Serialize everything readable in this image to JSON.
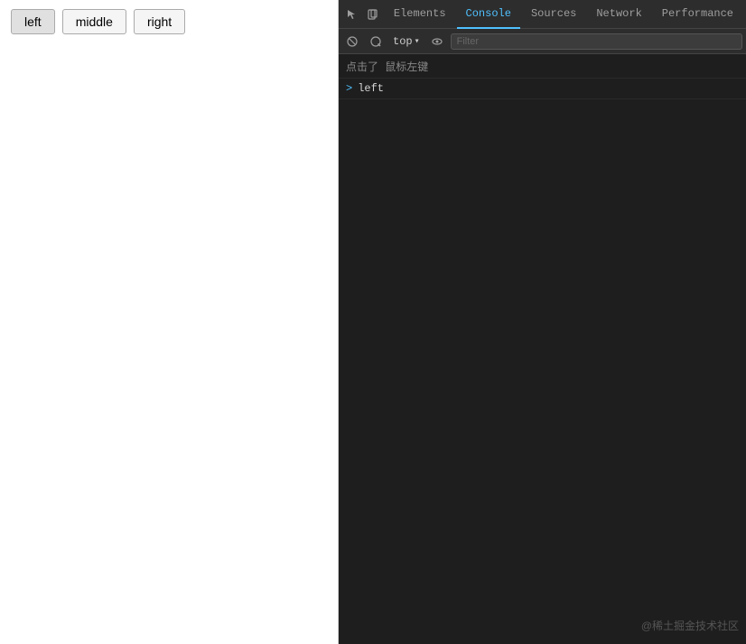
{
  "left_panel": {
    "buttons": [
      {
        "id": "btn-left",
        "label": "left",
        "active": true
      },
      {
        "id": "btn-middle",
        "label": "middle",
        "active": false
      },
      {
        "id": "btn-right",
        "label": "right",
        "active": false
      }
    ]
  },
  "devtools": {
    "tabs": [
      {
        "id": "elements",
        "label": "Elements",
        "active": false
      },
      {
        "id": "console",
        "label": "Console",
        "active": true
      },
      {
        "id": "sources",
        "label": "Sources",
        "active": false
      },
      {
        "id": "network",
        "label": "Network",
        "active": false
      },
      {
        "id": "performance",
        "label": "Performance",
        "active": false
      }
    ],
    "toolbar": {
      "top_label": "top",
      "filter_placeholder": "Filter"
    },
    "console_lines": [
      {
        "id": "line1",
        "type": "gray",
        "text": "点击了 鼠标左键"
      },
      {
        "id": "line2",
        "type": "white",
        "text": "left"
      }
    ],
    "prompt_symbol": ">"
  },
  "watermark": {
    "text": "@稀土掘金技术社区"
  }
}
